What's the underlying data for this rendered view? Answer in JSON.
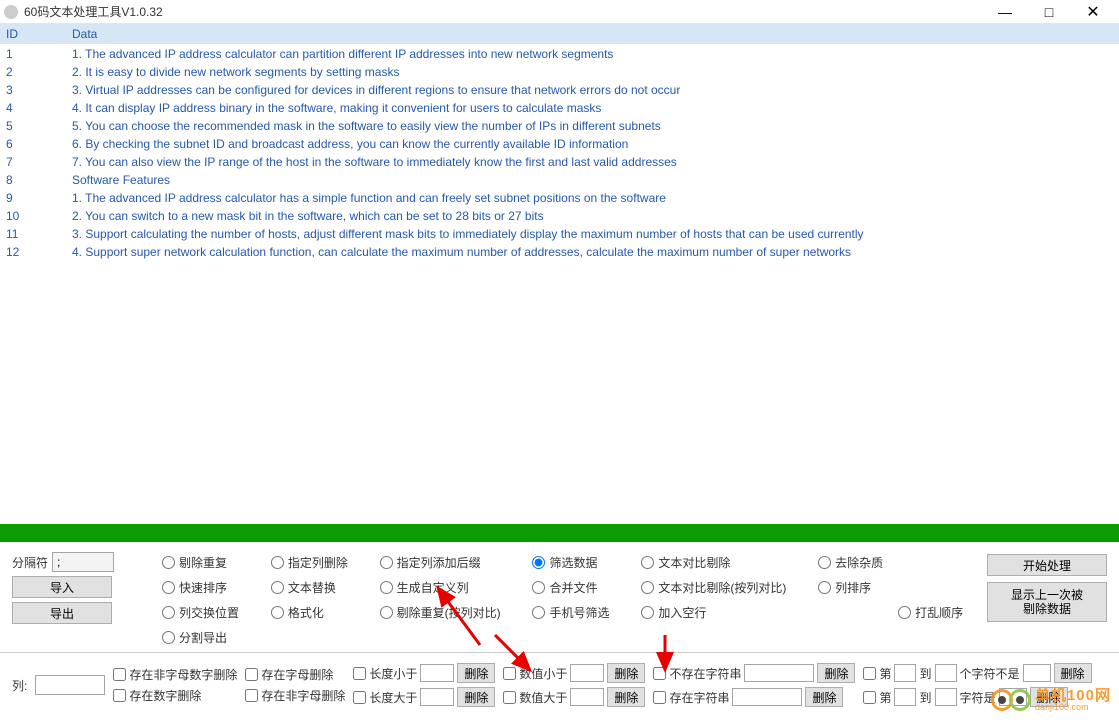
{
  "window": {
    "title": "60码文本处理工具V1.0.32",
    "min": "—",
    "max": "□",
    "close": "✕"
  },
  "table": {
    "headers": {
      "id": "ID",
      "data": "Data"
    },
    "rows": [
      {
        "id": "1",
        "data": "1. The advanced IP address calculator can partition different IP addresses into new network segments"
      },
      {
        "id": "2",
        "data": "2. It is easy to divide new network segments by setting masks"
      },
      {
        "id": "3",
        "data": "3. Virtual IP addresses can be configured for devices in different regions to ensure that network errors do not occur"
      },
      {
        "id": "4",
        "data": "4. It can display IP address binary in the software, making it convenient for users to calculate masks"
      },
      {
        "id": "5",
        "data": "5. You can choose the recommended mask in the software to easily view the number of IPs in different subnets"
      },
      {
        "id": "6",
        "data": "6. By checking the subnet ID and broadcast address, you can know the currently available ID information"
      },
      {
        "id": "7",
        "data": "7. You can also view the IP range of the host in the software to immediately know the first and last valid addresses"
      },
      {
        "id": "8",
        "data": "Software Features"
      },
      {
        "id": "9",
        "data": "1. The advanced IP address calculator has a simple function and can freely set subnet positions on the software"
      },
      {
        "id": "10",
        "data": "2. You can switch to a new mask bit in the software, which can be set to 28 bits or 27 bits"
      },
      {
        "id": "11",
        "data": "3. Support calculating the number of hosts, adjust different mask bits to immediately display the maximum number of hosts that can be used currently"
      },
      {
        "id": "12",
        "data": "4. Support super network calculation function, can calculate the maximum number of addresses, calculate the maximum number of super networks"
      }
    ]
  },
  "left": {
    "delim_label": "分隔符",
    "delim_value": ";",
    "import": "导入",
    "export": "导出"
  },
  "radios": {
    "r0": "剔除重复",
    "r1": "指定列删除",
    "r2": "指定列添加后缀",
    "r3": "筛选数据",
    "r4": "文本对比剔除",
    "r5": "去除杂质",
    "r6": "快速排序",
    "r7": "文本替换",
    "r8": "生成自定义列",
    "r9": "合并文件",
    "r10": "文本对比剔除(按列对比)",
    "r11": "列排序",
    "r12": "列交换位置",
    "r13": "格式化",
    "r14": "剔除重复(按列对比)",
    "r15": "手机号筛选",
    "r16": "加入空行",
    "r17": "分割导出",
    "r18": "打乱顺序"
  },
  "right": {
    "start": "开始处理",
    "show_last": "显示上一次被\n剔除数据"
  },
  "bottom": {
    "col_label": "列:",
    "chk1": "存在非字母数字删除",
    "chk2": "存在数字删除",
    "chk3": "存在字母删除",
    "chk4": "存在非字母删除",
    "len_lt": "长度小于",
    "len_gt": "长度大于",
    "val_lt": "数值小于",
    "val_gt": "数值大于",
    "not_contains": "不存在字符串",
    "contains": "存在字符串",
    "nth": "第",
    "to": "到",
    "char_not": "个字符不是",
    "char_is": "字符是",
    "delete": "删除"
  },
  "watermark": {
    "t1": "单机100网",
    "t2": "danji100.com"
  }
}
